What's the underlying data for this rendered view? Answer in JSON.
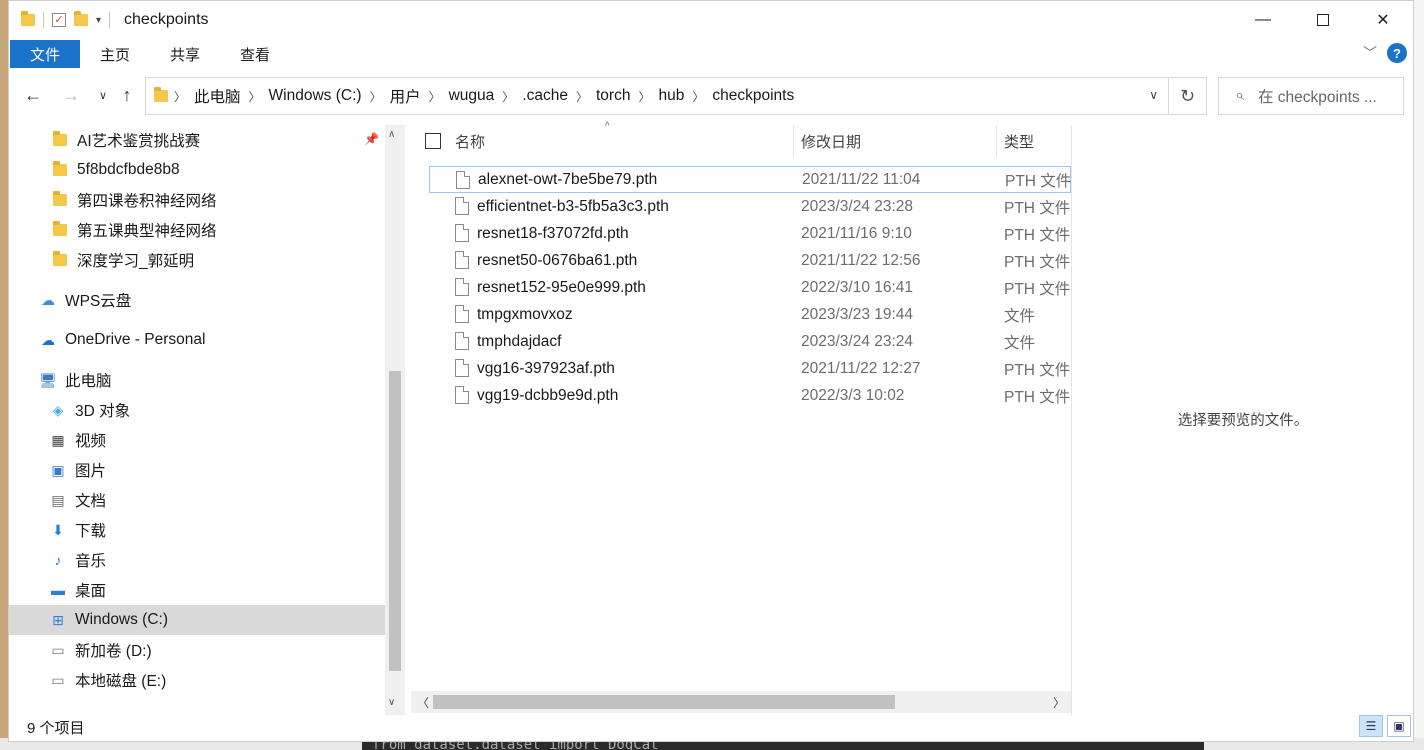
{
  "window": {
    "title": "checkpoints"
  },
  "ribbon": {
    "tabs": [
      "文件",
      "主页",
      "共享",
      "查看"
    ]
  },
  "address": {
    "crumbs": [
      "此电脑",
      "Windows (C:)",
      "用户",
      "wugua",
      ".cache",
      "torch",
      "hub",
      "checkpoints"
    ]
  },
  "search": {
    "placeholder": "在 checkpoints ..."
  },
  "nav": {
    "items": [
      {
        "label": "AI艺术鉴赏挑战赛",
        "icon": "folder-icon"
      },
      {
        "label": "5f8bdcfbde8b8",
        "icon": "folder-icon"
      },
      {
        "label": "第四课卷积神经网络",
        "icon": "folder-icon"
      },
      {
        "label": "第五课典型神经网络",
        "icon": "folder-icon"
      },
      {
        "label": "深度学习_郭延明",
        "icon": "folder-icon"
      },
      {
        "label": "WPS云盘",
        "icon": "cloud-icon"
      },
      {
        "label": "OneDrive - Personal",
        "icon": "cloud-icon"
      },
      {
        "label": "此电脑",
        "icon": "computer-icon"
      },
      {
        "label": "3D 对象",
        "icon": "3d-objects-icon"
      },
      {
        "label": "视频",
        "icon": "video-icon"
      },
      {
        "label": "图片",
        "icon": "pictures-icon"
      },
      {
        "label": "文档",
        "icon": "documents-icon"
      },
      {
        "label": "下载",
        "icon": "download-icon"
      },
      {
        "label": "音乐",
        "icon": "music-icon"
      },
      {
        "label": "桌面",
        "icon": "desktop-icon"
      },
      {
        "label": "Windows (C:)",
        "icon": "drive-icon"
      },
      {
        "label": "新加卷 (D:)",
        "icon": "drive-icon"
      },
      {
        "label": "本地磁盘 (E:)",
        "icon": "drive-icon"
      }
    ]
  },
  "columns": {
    "name": "名称",
    "date": "修改日期",
    "type": "类型"
  },
  "files": [
    {
      "name": "alexnet-owt-7be5be79.pth",
      "date": "2021/11/22 11:04",
      "type": "PTH 文件"
    },
    {
      "name": "efficientnet-b3-5fb5a3c3.pth",
      "date": "2023/3/24 23:28",
      "type": "PTH 文件"
    },
    {
      "name": "resnet18-f37072fd.pth",
      "date": "2021/11/16 9:10",
      "type": "PTH 文件"
    },
    {
      "name": "resnet50-0676ba61.pth",
      "date": "2021/11/22 12:56",
      "type": "PTH 文件"
    },
    {
      "name": "resnet152-95e0e999.pth",
      "date": "2022/3/10 16:41",
      "type": "PTH 文件"
    },
    {
      "name": "tmpgxmovxoz",
      "date": "2023/3/23 19:44",
      "type": "文件"
    },
    {
      "name": "tmphdajdacf",
      "date": "2023/3/24 23:24",
      "type": "文件"
    },
    {
      "name": "vgg16-397923af.pth",
      "date": "2021/11/22 12:27",
      "type": "PTH 文件"
    },
    {
      "name": "vgg19-dcbb9e9d.pth",
      "date": "2022/3/3 10:02",
      "type": "PTH 文件"
    }
  ],
  "preview": {
    "message": "选择要预览的文件。"
  },
  "status": {
    "count": "9 个项目"
  },
  "background": {
    "code_line": "from dataset.dataset import DogCat"
  },
  "colors": {
    "accent": "#1a73c8",
    "selection": "#d9d9d9",
    "focus_border": "#99c9ef"
  }
}
